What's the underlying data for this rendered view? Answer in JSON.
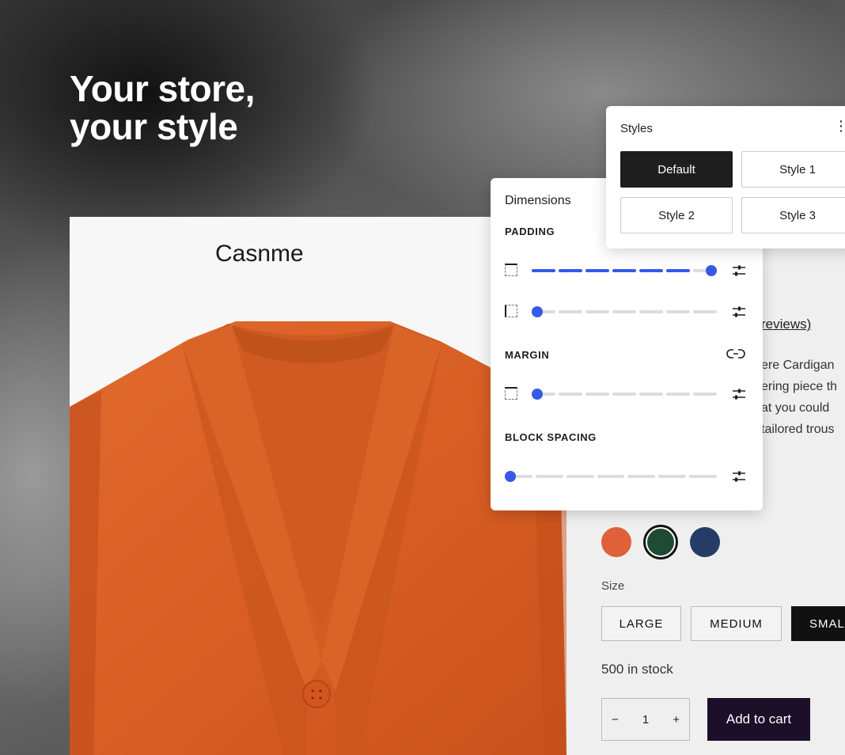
{
  "hero": {
    "line1": "Your store,",
    "line2": "your style"
  },
  "product": {
    "title_fragment": "Casnme",
    "reviews_fragment": "reviews)",
    "description_lines": [
      "ere Cardigan",
      "ering piece th",
      "at you could",
      "tailored trous"
    ],
    "colors": [
      "#e0603a",
      "#1f4a33",
      "#253d66"
    ],
    "selected_color_index": 1,
    "size_label": "Size",
    "sizes": [
      "LARGE",
      "MEDIUM",
      "SMAL"
    ],
    "selected_size_index": 2,
    "stock": "500 in stock",
    "quantity": {
      "minus": "−",
      "value": "1",
      "plus": "+"
    },
    "add_to_cart": "Add to cart"
  },
  "dimensions": {
    "title": "Dimensions",
    "padding_label": "PADDING",
    "margin_label": "MARGIN",
    "block_spacing_label": "BLOCK SPACING",
    "accent": "#3858e9",
    "sliders": {
      "padding_vertical": 1.0,
      "padding_horizontal": 0.0,
      "margin": 0.0,
      "block_spacing": 0.0
    }
  },
  "styles": {
    "title": "Styles",
    "kebab": "⋮",
    "options": [
      "Default",
      "Style 1",
      "Style 2",
      "Style 3"
    ],
    "active_index": 0
  }
}
